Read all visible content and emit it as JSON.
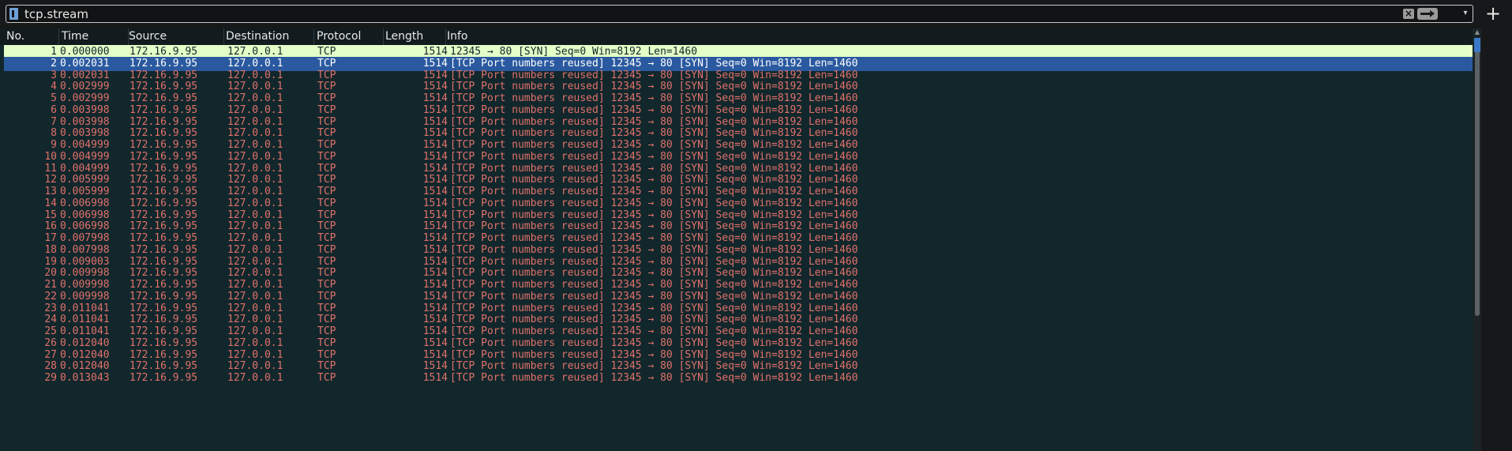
{
  "filter": {
    "value": "tcp.stream",
    "icons": [
      "bookmark-icon",
      "clear-icon",
      "apply-arrow-icon",
      "dropdown-icon",
      "add-icon"
    ]
  },
  "add_button_label": "+",
  "columns": {
    "no": "No.",
    "time": "Time",
    "source": "Source",
    "destination": "Destination",
    "protocol": "Protocol",
    "length": "Length",
    "info": "Info"
  },
  "colors": {
    "background": "#12272b",
    "row_text": "#e0716b",
    "first_row_bg": "#e4ffc7",
    "selected_row_bg": "#2a59a0"
  },
  "packets": [
    {
      "no": "1",
      "time": "0.000000",
      "source": "172.16.9.95",
      "destination": "127.0.0.1",
      "protocol": "TCP",
      "length": "1514",
      "info": "12345 → 80 [SYN] Seq=0 Win=8192 Len=1460"
    },
    {
      "no": "2",
      "time": "0.002031",
      "source": "172.16.9.95",
      "destination": "127.0.0.1",
      "protocol": "TCP",
      "length": "1514",
      "info": "[TCP Port numbers reused] 12345 → 80 [SYN] Seq=0 Win=8192 Len=1460"
    },
    {
      "no": "3",
      "time": "0.002031",
      "source": "172.16.9.95",
      "destination": "127.0.0.1",
      "protocol": "TCP",
      "length": "1514",
      "info": "[TCP Port numbers reused] 12345 → 80 [SYN] Seq=0 Win=8192 Len=1460"
    },
    {
      "no": "4",
      "time": "0.002999",
      "source": "172.16.9.95",
      "destination": "127.0.0.1",
      "protocol": "TCP",
      "length": "1514",
      "info": "[TCP Port numbers reused] 12345 → 80 [SYN] Seq=0 Win=8192 Len=1460"
    },
    {
      "no": "5",
      "time": "0.002999",
      "source": "172.16.9.95",
      "destination": "127.0.0.1",
      "protocol": "TCP",
      "length": "1514",
      "info": "[TCP Port numbers reused] 12345 → 80 [SYN] Seq=0 Win=8192 Len=1460"
    },
    {
      "no": "6",
      "time": "0.003998",
      "source": "172.16.9.95",
      "destination": "127.0.0.1",
      "protocol": "TCP",
      "length": "1514",
      "info": "[TCP Port numbers reused] 12345 → 80 [SYN] Seq=0 Win=8192 Len=1460"
    },
    {
      "no": "7",
      "time": "0.003998",
      "source": "172.16.9.95",
      "destination": "127.0.0.1",
      "protocol": "TCP",
      "length": "1514",
      "info": "[TCP Port numbers reused] 12345 → 80 [SYN] Seq=0 Win=8192 Len=1460"
    },
    {
      "no": "8",
      "time": "0.003998",
      "source": "172.16.9.95",
      "destination": "127.0.0.1",
      "protocol": "TCP",
      "length": "1514",
      "info": "[TCP Port numbers reused] 12345 → 80 [SYN] Seq=0 Win=8192 Len=1460"
    },
    {
      "no": "9",
      "time": "0.004999",
      "source": "172.16.9.95",
      "destination": "127.0.0.1",
      "protocol": "TCP",
      "length": "1514",
      "info": "[TCP Port numbers reused] 12345 → 80 [SYN] Seq=0 Win=8192 Len=1460"
    },
    {
      "no": "10",
      "time": "0.004999",
      "source": "172.16.9.95",
      "destination": "127.0.0.1",
      "protocol": "TCP",
      "length": "1514",
      "info": "[TCP Port numbers reused] 12345 → 80 [SYN] Seq=0 Win=8192 Len=1460"
    },
    {
      "no": "11",
      "time": "0.004999",
      "source": "172.16.9.95",
      "destination": "127.0.0.1",
      "protocol": "TCP",
      "length": "1514",
      "info": "[TCP Port numbers reused] 12345 → 80 [SYN] Seq=0 Win=8192 Len=1460"
    },
    {
      "no": "12",
      "time": "0.005999",
      "source": "172.16.9.95",
      "destination": "127.0.0.1",
      "protocol": "TCP",
      "length": "1514",
      "info": "[TCP Port numbers reused] 12345 → 80 [SYN] Seq=0 Win=8192 Len=1460"
    },
    {
      "no": "13",
      "time": "0.005999",
      "source": "172.16.9.95",
      "destination": "127.0.0.1",
      "protocol": "TCP",
      "length": "1514",
      "info": "[TCP Port numbers reused] 12345 → 80 [SYN] Seq=0 Win=8192 Len=1460"
    },
    {
      "no": "14",
      "time": "0.006998",
      "source": "172.16.9.95",
      "destination": "127.0.0.1",
      "protocol": "TCP",
      "length": "1514",
      "info": "[TCP Port numbers reused] 12345 → 80 [SYN] Seq=0 Win=8192 Len=1460"
    },
    {
      "no": "15",
      "time": "0.006998",
      "source": "172.16.9.95",
      "destination": "127.0.0.1",
      "protocol": "TCP",
      "length": "1514",
      "info": "[TCP Port numbers reused] 12345 → 80 [SYN] Seq=0 Win=8192 Len=1460"
    },
    {
      "no": "16",
      "time": "0.006998",
      "source": "172.16.9.95",
      "destination": "127.0.0.1",
      "protocol": "TCP",
      "length": "1514",
      "info": "[TCP Port numbers reused] 12345 → 80 [SYN] Seq=0 Win=8192 Len=1460"
    },
    {
      "no": "17",
      "time": "0.007998",
      "source": "172.16.9.95",
      "destination": "127.0.0.1",
      "protocol": "TCP",
      "length": "1514",
      "info": "[TCP Port numbers reused] 12345 → 80 [SYN] Seq=0 Win=8192 Len=1460"
    },
    {
      "no": "18",
      "time": "0.007998",
      "source": "172.16.9.95",
      "destination": "127.0.0.1",
      "protocol": "TCP",
      "length": "1514",
      "info": "[TCP Port numbers reused] 12345 → 80 [SYN] Seq=0 Win=8192 Len=1460"
    },
    {
      "no": "19",
      "time": "0.009003",
      "source": "172.16.9.95",
      "destination": "127.0.0.1",
      "protocol": "TCP",
      "length": "1514",
      "info": "[TCP Port numbers reused] 12345 → 80 [SYN] Seq=0 Win=8192 Len=1460"
    },
    {
      "no": "20",
      "time": "0.009998",
      "source": "172.16.9.95",
      "destination": "127.0.0.1",
      "protocol": "TCP",
      "length": "1514",
      "info": "[TCP Port numbers reused] 12345 → 80 [SYN] Seq=0 Win=8192 Len=1460"
    },
    {
      "no": "21",
      "time": "0.009998",
      "source": "172.16.9.95",
      "destination": "127.0.0.1",
      "protocol": "TCP",
      "length": "1514",
      "info": "[TCP Port numbers reused] 12345 → 80 [SYN] Seq=0 Win=8192 Len=1460"
    },
    {
      "no": "22",
      "time": "0.009998",
      "source": "172.16.9.95",
      "destination": "127.0.0.1",
      "protocol": "TCP",
      "length": "1514",
      "info": "[TCP Port numbers reused] 12345 → 80 [SYN] Seq=0 Win=8192 Len=1460"
    },
    {
      "no": "23",
      "time": "0.011041",
      "source": "172.16.9.95",
      "destination": "127.0.0.1",
      "protocol": "TCP",
      "length": "1514",
      "info": "[TCP Port numbers reused] 12345 → 80 [SYN] Seq=0 Win=8192 Len=1460"
    },
    {
      "no": "24",
      "time": "0.011041",
      "source": "172.16.9.95",
      "destination": "127.0.0.1",
      "protocol": "TCP",
      "length": "1514",
      "info": "[TCP Port numbers reused] 12345 → 80 [SYN] Seq=0 Win=8192 Len=1460"
    },
    {
      "no": "25",
      "time": "0.011041",
      "source": "172.16.9.95",
      "destination": "127.0.0.1",
      "protocol": "TCP",
      "length": "1514",
      "info": "[TCP Port numbers reused] 12345 → 80 [SYN] Seq=0 Win=8192 Len=1460"
    },
    {
      "no": "26",
      "time": "0.012040",
      "source": "172.16.9.95",
      "destination": "127.0.0.1",
      "protocol": "TCP",
      "length": "1514",
      "info": "[TCP Port numbers reused] 12345 → 80 [SYN] Seq=0 Win=8192 Len=1460"
    },
    {
      "no": "27",
      "time": "0.012040",
      "source": "172.16.9.95",
      "destination": "127.0.0.1",
      "protocol": "TCP",
      "length": "1514",
      "info": "[TCP Port numbers reused] 12345 → 80 [SYN] Seq=0 Win=8192 Len=1460"
    },
    {
      "no": "28",
      "time": "0.012040",
      "source": "172.16.9.95",
      "destination": "127.0.0.1",
      "protocol": "TCP",
      "length": "1514",
      "info": "[TCP Port numbers reused] 12345 → 80 [SYN] Seq=0 Win=8192 Len=1460"
    },
    {
      "no": "29",
      "time": "0.013043",
      "source": "172.16.9.95",
      "destination": "127.0.0.1",
      "protocol": "TCP",
      "length": "1514",
      "info": "[TCP Port numbers reused] 12345 → 80 [SYN] Seq=0 Win=8192 Len=1460"
    }
  ],
  "selected_row": "2"
}
